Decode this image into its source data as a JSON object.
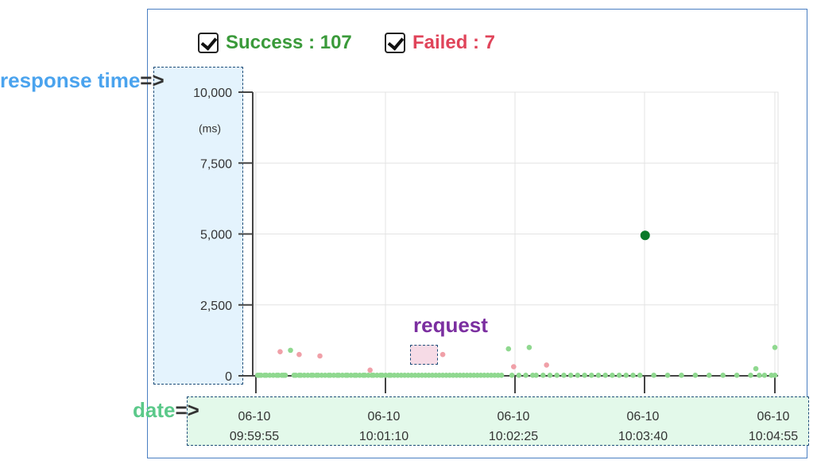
{
  "legend": {
    "success_label": "Success : 107",
    "failed_label": "Failed : 7",
    "success_color": "#3a9a3a",
    "failed_color": "#e0445a"
  },
  "annotations": {
    "response_time": "response time",
    "date": "date",
    "request": "request",
    "arrow": "=>",
    "response_time_color": "#4aa3ee",
    "date_color": "#5bc98a",
    "request_color": "#7b2fa0"
  },
  "chart_data": {
    "type": "scatter",
    "title": "",
    "xlabel": "",
    "ylabel": "(ms)",
    "ylim": [
      0,
      10000
    ],
    "yticks": [
      "10,000",
      "7,500",
      "5,000",
      "2,500",
      "0"
    ],
    "xticks": [
      {
        "date": "06-10",
        "time": "09:59:55"
      },
      {
        "date": "06-10",
        "time": "10:01:10"
      },
      {
        "date": "06-10",
        "time": "10:02:25"
      },
      {
        "date": "06-10",
        "time": "10:03:40"
      },
      {
        "date": "06-10",
        "time": "10:04:55"
      }
    ],
    "grid": true,
    "series": [
      {
        "name": "Success",
        "color": "#8fd88f",
        "points": [
          {
            "t": "09:59:56",
            "v": 20
          },
          {
            "t": "09:59:57",
            "v": 20
          },
          {
            "t": "09:59:58",
            "v": 20
          },
          {
            "t": "10:00:00",
            "v": 20
          },
          {
            "t": "10:00:01",
            "v": 20
          },
          {
            "t": "10:00:03",
            "v": 20
          },
          {
            "t": "10:00:05",
            "v": 20
          },
          {
            "t": "10:00:07",
            "v": 20
          },
          {
            "t": "10:00:08",
            "v": 20
          },
          {
            "t": "10:00:10",
            "v": 20
          },
          {
            "t": "10:00:11",
            "v": 20
          },
          {
            "t": "10:00:12",
            "v": 20
          },
          {
            "t": "10:00:15",
            "v": 900
          },
          {
            "t": "10:00:17",
            "v": 20
          },
          {
            "t": "10:00:18",
            "v": 20
          },
          {
            "t": "10:00:20",
            "v": 20
          },
          {
            "t": "10:00:21",
            "v": 20
          },
          {
            "t": "10:00:23",
            "v": 20
          },
          {
            "t": "10:00:25",
            "v": 20
          },
          {
            "t": "10:00:27",
            "v": 20
          },
          {
            "t": "10:00:28",
            "v": 20
          },
          {
            "t": "10:00:30",
            "v": 20
          },
          {
            "t": "10:00:31",
            "v": 20
          },
          {
            "t": "10:00:33",
            "v": 20
          },
          {
            "t": "10:00:35",
            "v": 20
          },
          {
            "t": "10:00:37",
            "v": 20
          },
          {
            "t": "10:00:38",
            "v": 20
          },
          {
            "t": "10:00:40",
            "v": 20
          },
          {
            "t": "10:00:42",
            "v": 20
          },
          {
            "t": "10:00:43",
            "v": 20
          },
          {
            "t": "10:00:45",
            "v": 20
          },
          {
            "t": "10:00:47",
            "v": 20
          },
          {
            "t": "10:00:48",
            "v": 20
          },
          {
            "t": "10:00:50",
            "v": 20
          },
          {
            "t": "10:00:52",
            "v": 20
          },
          {
            "t": "10:00:53",
            "v": 20
          },
          {
            "t": "10:00:55",
            "v": 20
          },
          {
            "t": "10:00:57",
            "v": 20
          },
          {
            "t": "10:00:58",
            "v": 20
          },
          {
            "t": "10:01:00",
            "v": 20
          },
          {
            "t": "10:01:02",
            "v": 20
          },
          {
            "t": "10:01:03",
            "v": 20
          },
          {
            "t": "10:01:05",
            "v": 20
          },
          {
            "t": "10:01:07",
            "v": 20
          },
          {
            "t": "10:01:08",
            "v": 20
          },
          {
            "t": "10:01:10",
            "v": 20
          },
          {
            "t": "10:01:12",
            "v": 20
          },
          {
            "t": "10:01:13",
            "v": 20
          },
          {
            "t": "10:01:15",
            "v": 20
          },
          {
            "t": "10:01:17",
            "v": 20
          },
          {
            "t": "10:01:19",
            "v": 20
          },
          {
            "t": "10:01:21",
            "v": 20
          },
          {
            "t": "10:01:23",
            "v": 20
          },
          {
            "t": "10:01:25",
            "v": 20
          },
          {
            "t": "10:01:27",
            "v": 20
          },
          {
            "t": "10:01:29",
            "v": 20
          },
          {
            "t": "10:01:31",
            "v": 20
          },
          {
            "t": "10:01:33",
            "v": 20
          },
          {
            "t": "10:01:35",
            "v": 20
          },
          {
            "t": "10:01:37",
            "v": 20
          },
          {
            "t": "10:01:39",
            "v": 20
          },
          {
            "t": "10:01:41",
            "v": 20
          },
          {
            "t": "10:01:43",
            "v": 20
          },
          {
            "t": "10:01:45",
            "v": 20
          },
          {
            "t": "10:01:47",
            "v": 20
          },
          {
            "t": "10:01:49",
            "v": 20
          },
          {
            "t": "10:01:51",
            "v": 20
          },
          {
            "t": "10:01:53",
            "v": 20
          },
          {
            "t": "10:01:55",
            "v": 20
          },
          {
            "t": "10:01:57",
            "v": 20
          },
          {
            "t": "10:01:59",
            "v": 20
          },
          {
            "t": "10:02:01",
            "v": 20
          },
          {
            "t": "10:02:03",
            "v": 20
          },
          {
            "t": "10:02:05",
            "v": 20
          },
          {
            "t": "10:02:07",
            "v": 20
          },
          {
            "t": "10:02:09",
            "v": 20
          },
          {
            "t": "10:02:11",
            "v": 20
          },
          {
            "t": "10:02:13",
            "v": 20
          },
          {
            "t": "10:02:15",
            "v": 20
          },
          {
            "t": "10:02:17",
            "v": 20
          },
          {
            "t": "10:02:21",
            "v": 950
          },
          {
            "t": "10:02:23",
            "v": 20
          },
          {
            "t": "10:02:27",
            "v": 20
          },
          {
            "t": "10:02:31",
            "v": 20
          },
          {
            "t": "10:02:33",
            "v": 1000
          },
          {
            "t": "10:02:35",
            "v": 20
          },
          {
            "t": "10:02:37",
            "v": 20
          },
          {
            "t": "10:02:41",
            "v": 20
          },
          {
            "t": "10:02:45",
            "v": 20
          },
          {
            "t": "10:02:49",
            "v": 20
          },
          {
            "t": "10:02:53",
            "v": 20
          },
          {
            "t": "10:02:57",
            "v": 20
          },
          {
            "t": "10:03:01",
            "v": 20
          },
          {
            "t": "10:03:05",
            "v": 20
          },
          {
            "t": "10:03:09",
            "v": 20
          },
          {
            "t": "10:03:13",
            "v": 20
          },
          {
            "t": "10:03:17",
            "v": 20
          },
          {
            "t": "10:03:21",
            "v": 20
          },
          {
            "t": "10:03:25",
            "v": 20
          },
          {
            "t": "10:03:29",
            "v": 20
          },
          {
            "t": "10:03:33",
            "v": 20
          },
          {
            "t": "10:03:37",
            "v": 20
          },
          {
            "t": "10:03:40",
            "v": 4950,
            "highlight": true
          },
          {
            "t": "10:03:45",
            "v": 20
          },
          {
            "t": "10:03:53",
            "v": 20
          },
          {
            "t": "10:04:01",
            "v": 20
          },
          {
            "t": "10:04:09",
            "v": 20
          },
          {
            "t": "10:04:17",
            "v": 20
          },
          {
            "t": "10:04:25",
            "v": 20
          },
          {
            "t": "10:04:33",
            "v": 20
          },
          {
            "t": "10:04:41",
            "v": 20
          },
          {
            "t": "10:04:44",
            "v": 250
          },
          {
            "t": "10:04:46",
            "v": 20
          },
          {
            "t": "10:04:49",
            "v": 20
          },
          {
            "t": "10:04:53",
            "v": 20
          },
          {
            "t": "10:04:55",
            "v": 20
          },
          {
            "t": "10:04:55",
            "v": 1000
          }
        ]
      },
      {
        "name": "Failed",
        "color": "#f0a0a8",
        "points": [
          {
            "t": "10:00:09",
            "v": 850
          },
          {
            "t": "10:00:20",
            "v": 750
          },
          {
            "t": "10:00:32",
            "v": 700
          },
          {
            "t": "10:01:01",
            "v": 200
          },
          {
            "t": "10:01:43",
            "v": 750
          },
          {
            "t": "10:02:24",
            "v": 320
          },
          {
            "t": "10:02:43",
            "v": 380
          }
        ]
      }
    ]
  }
}
